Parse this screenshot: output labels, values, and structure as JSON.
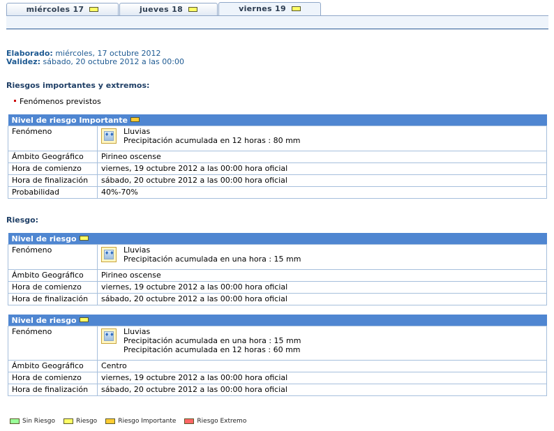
{
  "tabs": [
    {
      "label": "miércoles 17",
      "level": "yellow"
    },
    {
      "label": "jueves 18",
      "level": "yellow"
    },
    {
      "label": "viernes 19",
      "level": "yellow",
      "active": true
    }
  ],
  "meta": {
    "elaborado_label": "Elaborado:",
    "elaborado_value": "miércoles, 17 octubre 2012",
    "validez_label": "Validez:",
    "validez_value": "sábado, 20 octubre 2012 a las 00:00"
  },
  "section1": {
    "heading": "Riesgos importantes y extremos:",
    "bullet": "Fenómenos previstos",
    "table": {
      "title": "Nivel de riesgo Importante",
      "level_color": "#ffcc33",
      "fenomeno_label": "Fenómeno",
      "fenomeno_name": "Lluvias",
      "fenomeno_details": [
        "Precipitación acumulada en 12 horas : 80 mm"
      ],
      "ambito_label": "Ámbito Geográfico",
      "ambito_value": "Pirineo oscense",
      "comienzo_label": "Hora de comienzo",
      "comienzo_value": "viernes, 19 octubre 2012 a las 00:00 hora oficial",
      "fin_label": "Hora de finalización",
      "fin_value": "sábado, 20 octubre 2012 a las 00:00 hora oficial",
      "prob_label": "Probabilidad",
      "prob_value": "40%-70%"
    }
  },
  "section2": {
    "heading": "Riesgo:",
    "tables": [
      {
        "title": "Nivel de riesgo",
        "fenomeno_label": "Fenómeno",
        "fenomeno_name": "Lluvias",
        "fenomeno_details": [
          "Precipitación acumulada en una hora : 15 mm"
        ],
        "ambito_label": "Ámbito Geográfico",
        "ambito_value": "Pirineo oscense",
        "comienzo_label": "Hora de comienzo",
        "comienzo_value": "viernes, 19 octubre 2012 a las 00:00 hora oficial",
        "fin_label": "Hora de finalización",
        "fin_value": "sábado, 20 octubre 2012 a las 00:00 hora oficial"
      },
      {
        "title": "Nivel de riesgo",
        "fenomeno_label": "Fenómeno",
        "fenomeno_name": "Lluvias",
        "fenomeno_details": [
          "Precipitación acumulada en una hora : 15 mm",
          "Precipitación acumulada en 12 horas : 60 mm"
        ],
        "ambito_label": "Ámbito Geográfico",
        "ambito_value": "Centro",
        "comienzo_label": "Hora de comienzo",
        "comienzo_value": "viernes, 19 octubre 2012 a las 00:00 hora oficial",
        "fin_label": "Hora de finalización",
        "fin_value": "sábado, 20 octubre 2012 a las 00:00 hora oficial"
      }
    ]
  },
  "legend": [
    {
      "label": "Sin Riesgo",
      "color": "#99ff99"
    },
    {
      "label": "Riesgo",
      "color": "#ffff66"
    },
    {
      "label": "Riesgo Importante",
      "color": "#ffcc33"
    },
    {
      "label": "Riesgo Extremo",
      "color": "#ff6666"
    }
  ],
  "colors": {
    "header_blue": "#4f86d1",
    "text_blue": "#1e5a92"
  },
  "icons": {
    "fenomeno": "rain-icon",
    "level": "level-flag-icon"
  }
}
